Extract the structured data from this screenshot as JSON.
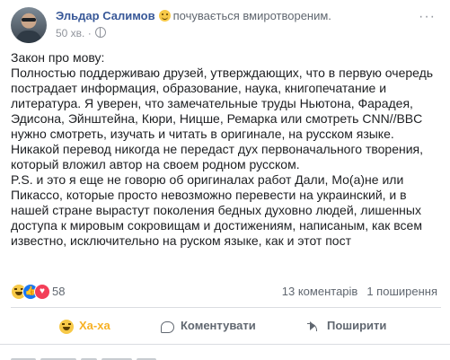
{
  "post": {
    "author": "Эльдар Салимов",
    "feeling_text": "почувається вмиротвореним.",
    "timestamp": "50 хв.",
    "more_label": "···",
    "paragraphs": [
      "Закон про мову:",
      "Полностью поддерживаю друзей, утверждающих, что в первую очередь пострадает информация, образование, наука, книгопечатание и литература. Я уверен, что замечательные труды Ньютона, Фарадея, Эдисона, Эйнштейна, Кюри, Ницше, Ремарка или смотреть CNN//BBC нужно смотреть, изучать и читать в оригинале, на русском языке. Никакой перевод никогда не передаст дух первоначального творения, который вложил автор на своем родном русском.",
      "P.S. и это я еще не говорю об оригиналах работ Дали, Мо(а)не или Пикассо, которые просто невозможно перевести на украинский, и в нашей стране вырастут поколения бедных духовно людей, лишенных доступа к мировым сокровищам и достижениям, написаным, как всем известно, исключительно на руском языке, как и этот пост"
    ],
    "reaction_count": "58",
    "comments_count": "13 коментарів",
    "shares_count": "1 поширення"
  },
  "actions": {
    "haha_label": "Ха-ха",
    "comment_label": "Коментувати",
    "share_label": "Поширити"
  },
  "colors": {
    "author_link": "#385898",
    "haha_active": "#f7b125",
    "muted": "#606770"
  }
}
